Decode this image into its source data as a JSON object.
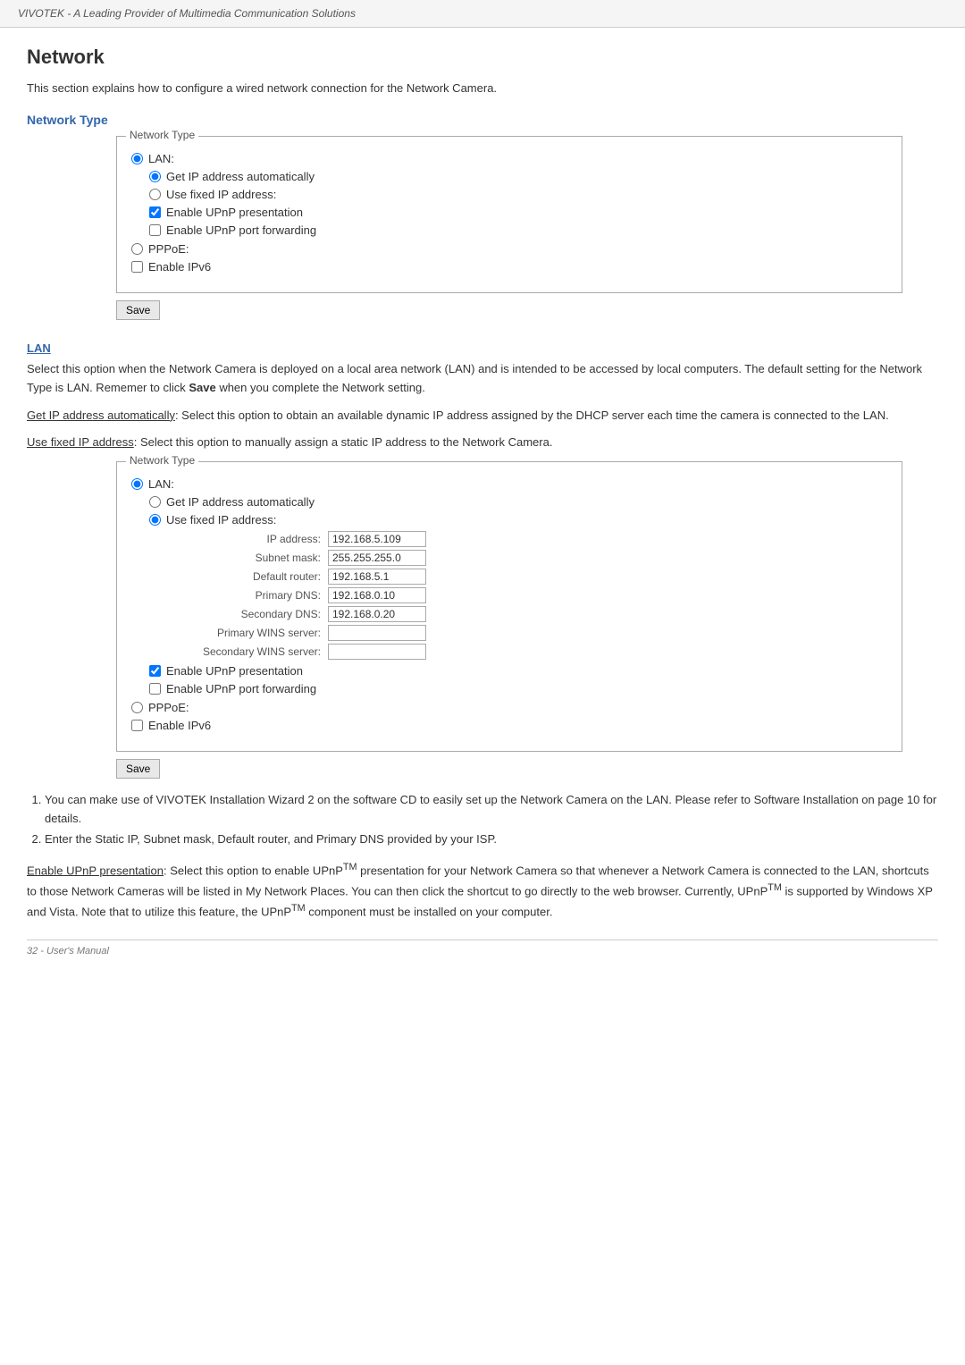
{
  "header": {
    "tagline": "VIVOTEK - A Leading Provider of Multimedia Communication Solutions"
  },
  "page": {
    "title": "Network",
    "intro": "This section explains how to configure a wired network connection for the Network Camera.",
    "network_type_heading": "Network Type",
    "network_type_box_title": "Network Type",
    "lan_radio_label": "LAN:",
    "get_ip_auto_label": "Get IP address automatically",
    "use_fixed_ip_label": "Use fixed IP address:",
    "enable_upnp_label": "Enable UPnP presentation",
    "enable_upnp_port_label": "Enable UPnP port forwarding",
    "pppoe_label": "PPPoE:",
    "enable_ipv6_label": "Enable IPv6",
    "save_label": "Save",
    "lan_heading": "LAN",
    "lan_body1": "Select this option when the Network Camera is deployed on a local area network (LAN) and is intended to be accessed by local computers. The default setting for the Network Type is LAN. Rememer to click Save when you complete the Network setting.",
    "lan_body1_bold": "Save",
    "get_ip_body": "Get IP address automatically: Select this option to obtain an available dynamic IP address assigned by the DHCP server each time the camera is connected to the LAN.",
    "use_fixed_body": "Use fixed IP address: Select this option to manually assign a static IP address to the Network Camera.",
    "network_type_box2_title": "Network Type",
    "ip_address_label": "IP address:",
    "ip_address_value": "192.168.5.109",
    "subnet_mask_label": "Subnet mask:",
    "subnet_mask_value": "255.255.255.0",
    "default_router_label": "Default router:",
    "default_router_value": "192.168.5.1",
    "primary_dns_label": "Primary DNS:",
    "primary_dns_value": "192.168.0.10",
    "secondary_dns_label": "Secondary DNS:",
    "secondary_dns_value": "192.168.0.20",
    "primary_wins_label": "Primary WINS server:",
    "primary_wins_value": "",
    "secondary_wins_label": "Secondary WINS server:",
    "secondary_wins_value": "",
    "note1": "1. You can make use of VIVOTEK Installation Wizard 2 on the software CD to easily set up the Network Camera on the LAN. Please refer to Software Installation on page 10 for details.",
    "note2": "2. Enter the Static IP, Subnet mask, Default router, and Primary DNS provided by your ISP.",
    "enable_upnp_heading": "Enable UPnP presentation",
    "enable_upnp_body": "Select this option to enable UPnPTM presentation for your Network Camera so that whenever a Network Camera is connected to the LAN, shortcuts to those Network Cameras will be listed in My Network Places. You can then click the shortcut to go directly to the web browser. Currently, UPnPTM is supported by Windows XP and Vista. Note that to utilize this feature,  the UPnPTM component must be installed on your computer.",
    "page_footer": "32 - User's Manual"
  }
}
